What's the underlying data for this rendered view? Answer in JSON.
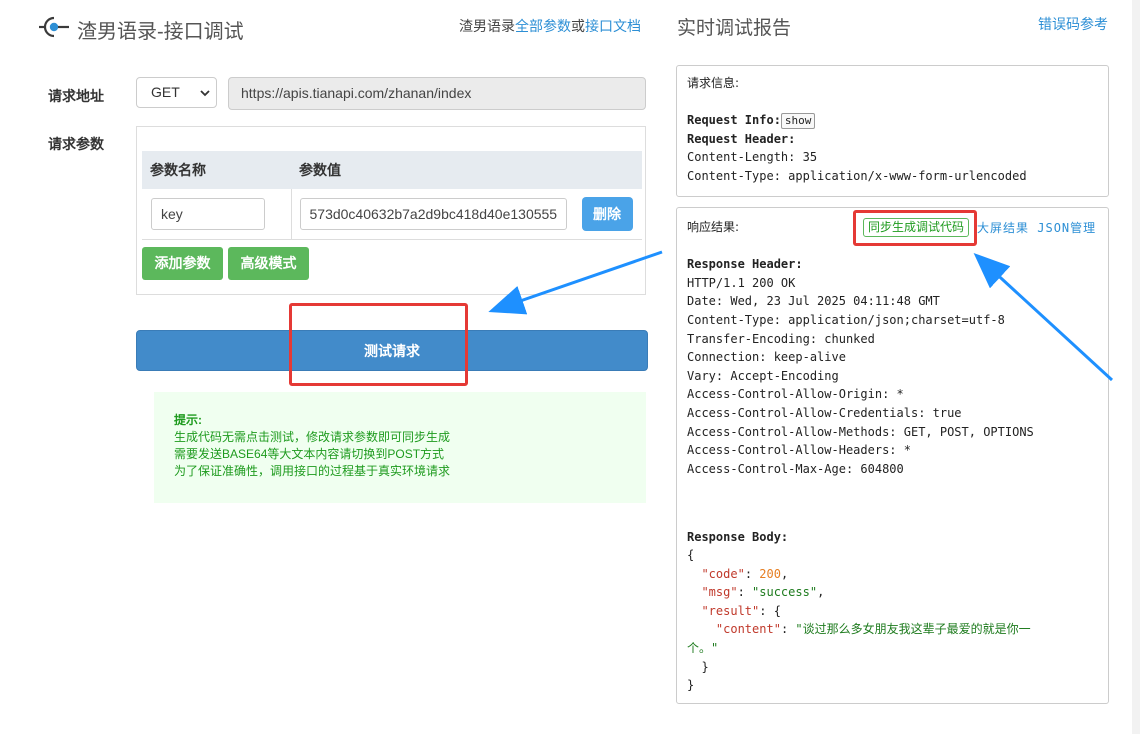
{
  "header": {
    "title": "渣男语录-接口调试",
    "links_prefix": "渣男语录",
    "all_params_link": "全部参数",
    "or_text": "或",
    "doc_link": "接口文档"
  },
  "form": {
    "url_label": "请求地址",
    "method": "GET",
    "url": "https://apis.tianapi.com/zhanan/index",
    "params_label": "请求参数",
    "col_name": "参数名称",
    "col_value": "参数值",
    "params": [
      {
        "name": "key",
        "value": "573d0c40632b7a2d9bc418d40e130555",
        "delete_label": "删除"
      }
    ],
    "add_param_label": "添加参数",
    "advanced_label": "高级模式",
    "test_button": "测试请求"
  },
  "tips": {
    "title": "提示:",
    "lines": [
      "生成代码无需点击测试，修改请求参数即可同步生成",
      "需要发送BASE64等大文本内容请切换到POST方式",
      "为了保证准确性，调用接口的过程基于真实环境请求"
    ]
  },
  "report": {
    "title": "实时调试报告",
    "error_codes_link": "错误码参考",
    "request_section": "请求信息:",
    "request_info_label": "Request Info:",
    "show_button": "show",
    "request_header_label": "Request Header:",
    "request_headers": [
      "Content-Length: 35",
      "Content-Type: application/x-www-form-urlencoded"
    ],
    "response_section": "响应结果:",
    "gen_code_button": "同步生成调试代码",
    "fullscreen_link": "大屏结果",
    "json_link": "JSON管理",
    "response_header_label": "Response Header:",
    "response_headers": [
      "HTTP/1.1 200 OK",
      "Date: Wed, 23 Jul 2025 04:11:48 GMT",
      "Content-Type: application/json;charset=utf-8",
      "Transfer-Encoding: chunked",
      "Connection: keep-alive",
      "Vary: Accept-Encoding",
      "Access-Control-Allow-Origin: *",
      "Access-Control-Allow-Credentials: true",
      "Access-Control-Allow-Methods: GET, POST, OPTIONS",
      "Access-Control-Allow-Headers: *",
      "Access-Control-Max-Age: 604800"
    ],
    "response_body_label": "Response Body:",
    "body": {
      "open": "{",
      "code_key": "\"code\"",
      "code_val": "200",
      "msg_key": "\"msg\"",
      "msg_val": "\"success\"",
      "result_key": "\"result\"",
      "content_key": "\"content\"",
      "content_val_1": "\"谈过那么多女朋友我这辈子最爱的就是你一",
      "content_val_2": "个。\"",
      "inner_close": "}",
      "close": "}"
    }
  },
  "colors": {
    "primary": "#428bca",
    "link": "#2d8fd5",
    "green": "#5cb85c",
    "highlight": "#e53935",
    "arrow": "#1e90ff"
  }
}
